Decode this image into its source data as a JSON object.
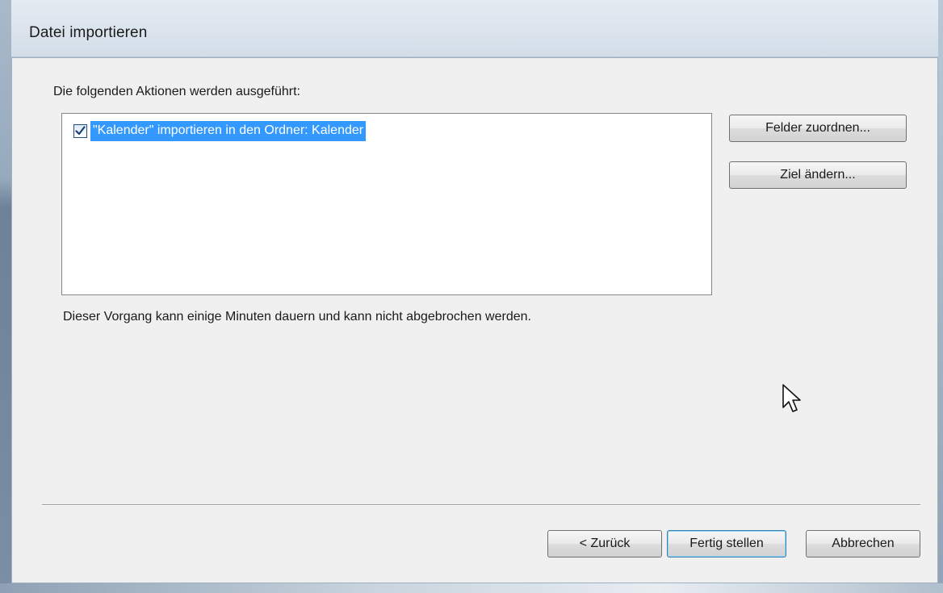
{
  "window": {
    "title": "Datei importieren"
  },
  "content": {
    "instruction": "Die folgenden Aktionen werden ausgeführt:",
    "actions": [
      {
        "label": "\"Kalender\" importieren in den Ordner: Kalender",
        "checked": true,
        "selected": true
      }
    ],
    "note": "Dieser Vorgang kann einige Minuten dauern und kann nicht abgebrochen werden."
  },
  "side_buttons": {
    "map_fields": "Felder zuordnen...",
    "change_target": "Ziel ändern..."
  },
  "footer": {
    "back": "< Zurück",
    "finish": "Fertig stellen",
    "cancel": "Abbrechen"
  },
  "icons": {
    "checkbox": "checkmark-icon",
    "cursor": "mouse-pointer-icon"
  },
  "colors": {
    "selection": "#3399ff",
    "dialog_bg": "#f0f0f0",
    "default_button_border": "#3c7fb1"
  }
}
